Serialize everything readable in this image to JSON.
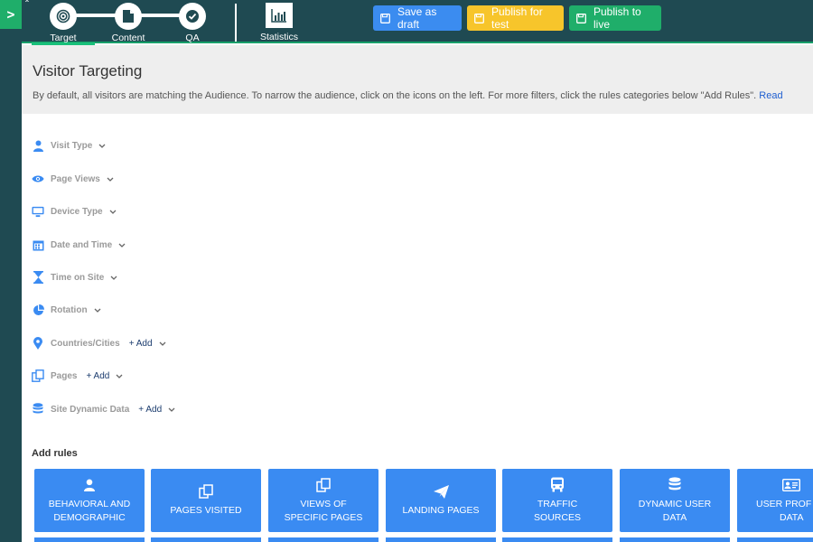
{
  "rail": {
    "toggle": ">"
  },
  "topbar": {
    "steps": [
      {
        "label": "Target",
        "icon": "target-icon"
      },
      {
        "label": "Content",
        "icon": "document-icon"
      },
      {
        "label": "QA",
        "icon": "check-circle-icon"
      }
    ],
    "statistics_label": "Statistics",
    "buttons": {
      "draft": "Save as draft",
      "test": "Publish for test",
      "live": "Publish to live"
    },
    "colors": {
      "bar": "#1f4a52",
      "draft": "#3b8cf0",
      "test": "#f7c52b",
      "live": "#1fae6a"
    }
  },
  "header": {
    "title": "Visitor Targeting",
    "description": "By default, all visitors are matching the Audience. To narrow the audience, click on the icons on the left. For more filters, click the rules categories below \"Add Rules\".",
    "link": "Read"
  },
  "filters": [
    {
      "label": "Visit Type",
      "icon": "user-icon"
    },
    {
      "label": "Page Views",
      "icon": "eye-icon"
    },
    {
      "label": "Device Type",
      "icon": "monitor-icon"
    },
    {
      "label": "Date and Time",
      "icon": "calendar-icon"
    },
    {
      "label": "Time on Site",
      "icon": "hourglass-icon"
    },
    {
      "label": "Rotation",
      "icon": "pie-icon"
    },
    {
      "label": "Countries/Cities",
      "icon": "map-pin-icon",
      "add": "+ Add"
    },
    {
      "label": "Pages",
      "icon": "pages-icon",
      "add": "+ Add"
    },
    {
      "label": "Site Dynamic Data",
      "icon": "database-icon",
      "add": "+ Add"
    }
  ],
  "rules": {
    "title": "Add rules",
    "tiles": [
      {
        "line1": "BEHAVIORAL AND",
        "line2": "DEMOGRAPHIC",
        "icon": "user-icon"
      },
      {
        "line1": "PAGES VISITED",
        "line2": "",
        "icon": "pages-icon"
      },
      {
        "line1": "VIEWS OF",
        "line2": "SPECIFIC PAGES",
        "icon": "pages-icon"
      },
      {
        "line1": "LANDING PAGES",
        "line2": "",
        "icon": "paper-plane-icon"
      },
      {
        "line1": "TRAFFIC",
        "line2": "SOURCES",
        "icon": "bus-icon"
      },
      {
        "line1": "DYNAMIC USER",
        "line2": "DATA",
        "icon": "database-icon"
      },
      {
        "line1": "USER PROF",
        "line2": "DATA",
        "icon": "id-card-icon"
      }
    ]
  }
}
